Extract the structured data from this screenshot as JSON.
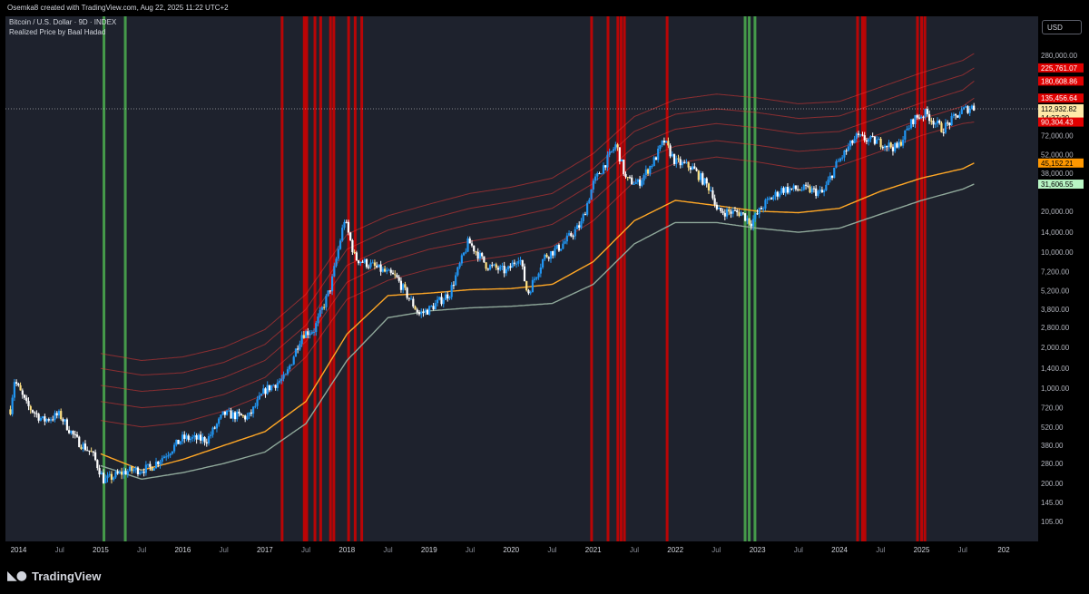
{
  "header": {
    "attribution": "Osemka8 created with TradingView.com, Aug 22, 2025 11:22 UTC+2"
  },
  "legend": {
    "symbol": "Bitcoin / U.S. Dollar · 9D · INDEX",
    "indicator": "Realized Price by Baal Hadad"
  },
  "currency": "USD",
  "footer": {
    "brand": "TradingView",
    "logo_icon": "tradingview-logo-icon"
  },
  "colors": {
    "background": "#1e222d",
    "candle_up": "#2196f3",
    "candle_down": "#ffffff",
    "candle_highlight": "#ffe082",
    "realized_band": "#e53935",
    "realized_price": "#ffa726",
    "lower_band": "#8fa89a",
    "red_zone": "#d50000",
    "green_zone": "#4caf50"
  },
  "chart_data": {
    "type": "candlestick",
    "title": "Bitcoin / U.S. Dollar · 9D · INDEX",
    "yscale": "log",
    "ylim": [
      75,
      540000
    ],
    "xlim": [
      2013.84,
      2026.42
    ],
    "grid": false,
    "y_ticks": [
      105,
      145,
      200,
      280,
      380,
      520,
      720,
      1000,
      1400,
      2000,
      2800,
      3800,
      5200,
      7200,
      10000,
      14000,
      20000,
      38000,
      52000,
      72000,
      280000
    ],
    "y_tick_labels": [
      "105.00",
      "145.00",
      "200.00",
      "280.00",
      "380.00",
      "520.00",
      "720.00",
      "1,000.00",
      "1,400.00",
      "2,000.00",
      "2,800.00",
      "3,800.00",
      "5,200.00",
      "7,200.00",
      "10,000.00",
      "14,000.00",
      "20,000.00",
      "38,000.00",
      "52,000.00",
      "72,000.00",
      "280,000.00"
    ],
    "x_ticks": [
      {
        "t": 2014.0,
        "label": "2014"
      },
      {
        "t": 2014.5,
        "label": "Jul"
      },
      {
        "t": 2015.0,
        "label": "2015"
      },
      {
        "t": 2015.5,
        "label": "Jul"
      },
      {
        "t": 2016.0,
        "label": "2016"
      },
      {
        "t": 2016.5,
        "label": "Jul"
      },
      {
        "t": 2017.0,
        "label": "2017"
      },
      {
        "t": 2017.5,
        "label": "Jul"
      },
      {
        "t": 2018.0,
        "label": "2018"
      },
      {
        "t": 2018.5,
        "label": "Jul"
      },
      {
        "t": 2019.0,
        "label": "2019"
      },
      {
        "t": 2019.5,
        "label": "Jul"
      },
      {
        "t": 2020.0,
        "label": "2020"
      },
      {
        "t": 2020.5,
        "label": "Jul"
      },
      {
        "t": 2021.0,
        "label": "2021"
      },
      {
        "t": 2021.5,
        "label": "Jul"
      },
      {
        "t": 2022.0,
        "label": "2022"
      },
      {
        "t": 2022.5,
        "label": "Jul"
      },
      {
        "t": 2023.0,
        "label": "2023"
      },
      {
        "t": 2023.5,
        "label": "Jul"
      },
      {
        "t": 2024.0,
        "label": "2024"
      },
      {
        "t": 2024.5,
        "label": "Jul"
      },
      {
        "t": 2025.0,
        "label": "2025"
      },
      {
        "t": 2025.5,
        "label": "Jul"
      },
      {
        "t": 2026.0,
        "label": "202"
      }
    ],
    "price_path": [
      [
        2013.9,
        700
      ],
      [
        2013.95,
        1150
      ],
      [
        2014.1,
        750
      ],
      [
        2014.3,
        580
      ],
      [
        2014.5,
        640
      ],
      [
        2014.7,
        420
      ],
      [
        2014.9,
        330
      ],
      [
        2015.04,
        210
      ],
      [
        2015.3,
        245
      ],
      [
        2015.6,
        260
      ],
      [
        2015.8,
        330
      ],
      [
        2016.0,
        430
      ],
      [
        2016.3,
        420
      ],
      [
        2016.5,
        650
      ],
      [
        2016.8,
        610
      ],
      [
        2017.0,
        970
      ],
      [
        2017.25,
        1200
      ],
      [
        2017.45,
        2500
      ],
      [
        2017.6,
        2700
      ],
      [
        2017.8,
        5500
      ],
      [
        2017.97,
        17500
      ],
      [
        2018.1,
        9000
      ],
      [
        2018.3,
        8000
      ],
      [
        2018.6,
        6500
      ],
      [
        2018.88,
        3500
      ],
      [
        2019.0,
        3800
      ],
      [
        2019.25,
        5000
      ],
      [
        2019.48,
        12000
      ],
      [
        2019.7,
        8000
      ],
      [
        2019.95,
        7200
      ],
      [
        2020.1,
        9500
      ],
      [
        2020.2,
        4900
      ],
      [
        2020.4,
        9200
      ],
      [
        2020.6,
        11000
      ],
      [
        2020.85,
        16000
      ],
      [
        2021.0,
        32000
      ],
      [
        2021.28,
        62000
      ],
      [
        2021.4,
        34000
      ],
      [
        2021.55,
        32000
      ],
      [
        2021.75,
        48000
      ],
      [
        2021.86,
        66000
      ],
      [
        2022.0,
        46000
      ],
      [
        2022.2,
        42000
      ],
      [
        2022.45,
        28000
      ],
      [
        2022.5,
        20000
      ],
      [
        2022.8,
        19500
      ],
      [
        2022.92,
        16500
      ],
      [
        2023.1,
        23000
      ],
      [
        2023.3,
        29000
      ],
      [
        2023.6,
        29000
      ],
      [
        2023.8,
        27000
      ],
      [
        2023.95,
        43000
      ],
      [
        2024.2,
        70000
      ],
      [
        2024.5,
        64000
      ],
      [
        2024.7,
        58000
      ],
      [
        2024.9,
        95000
      ],
      [
        2025.05,
        105000
      ],
      [
        2025.25,
        80000
      ],
      [
        2025.5,
        110000
      ],
      [
        2025.63,
        118000
      ],
      [
        2025.64,
        112932.82
      ]
    ],
    "series": [
      {
        "name": "Realized Price",
        "role": "realized-price",
        "color": "#ffa726",
        "points": [
          [
            2015.0,
            330
          ],
          [
            2015.5,
            250
          ],
          [
            2016.0,
            300
          ],
          [
            2016.5,
            380
          ],
          [
            2017.0,
            480
          ],
          [
            2017.5,
            800
          ],
          [
            2018.0,
            2500
          ],
          [
            2018.5,
            4800
          ],
          [
            2019.0,
            5000
          ],
          [
            2019.5,
            5300
          ],
          [
            2020.0,
            5400
          ],
          [
            2020.5,
            5800
          ],
          [
            2021.0,
            8500
          ],
          [
            2021.5,
            17000
          ],
          [
            2022.0,
            24000
          ],
          [
            2022.5,
            22000
          ],
          [
            2023.0,
            20000
          ],
          [
            2023.5,
            19500
          ],
          [
            2024.0,
            21000
          ],
          [
            2024.5,
            28000
          ],
          [
            2025.0,
            35000
          ],
          [
            2025.5,
            41000
          ],
          [
            2025.64,
            45152.21
          ]
        ]
      },
      {
        "name": "Lower Band",
        "role": "lower-band",
        "color": "#8fa89a",
        "points": [
          [
            2015.0,
            270
          ],
          [
            2015.5,
            215
          ],
          [
            2016.0,
            240
          ],
          [
            2016.5,
            280
          ],
          [
            2017.0,
            340
          ],
          [
            2017.5,
            550
          ],
          [
            2018.0,
            1600
          ],
          [
            2018.5,
            3300
          ],
          [
            2019.0,
            3700
          ],
          [
            2019.5,
            3900
          ],
          [
            2020.0,
            4000
          ],
          [
            2020.5,
            4200
          ],
          [
            2021.0,
            5800
          ],
          [
            2021.5,
            11500
          ],
          [
            2022.0,
            16500
          ],
          [
            2022.5,
            16500
          ],
          [
            2023.0,
            15000
          ],
          [
            2023.5,
            14000
          ],
          [
            2024.0,
            15000
          ],
          [
            2024.5,
            19000
          ],
          [
            2025.0,
            24000
          ],
          [
            2025.5,
            29000
          ],
          [
            2025.64,
            31606.55
          ]
        ]
      },
      {
        "name": "Band 1",
        "role": "red-band",
        "color": "#e53935",
        "points": [
          [
            2015.0,
            580
          ],
          [
            2015.5,
            520
          ],
          [
            2016.0,
            560
          ],
          [
            2016.5,
            680
          ],
          [
            2017.0,
            900
          ],
          [
            2017.5,
            1700
          ],
          [
            2018.0,
            4500
          ],
          [
            2018.5,
            6200
          ],
          [
            2019.0,
            7500
          ],
          [
            2019.5,
            8600
          ],
          [
            2020.0,
            9500
          ],
          [
            2020.5,
            11000
          ],
          [
            2021.0,
            17000
          ],
          [
            2021.5,
            33000
          ],
          [
            2022.0,
            45000
          ],
          [
            2022.5,
            50000
          ],
          [
            2023.0,
            46000
          ],
          [
            2023.5,
            41000
          ],
          [
            2024.0,
            43000
          ],
          [
            2024.5,
            55000
          ],
          [
            2025.0,
            72000
          ],
          [
            2025.5,
            88000
          ],
          [
            2025.64,
            90304.43
          ]
        ]
      },
      {
        "name": "Band 2",
        "role": "red-band",
        "color": "#e53935",
        "points": [
          [
            2015.0,
            800
          ],
          [
            2015.5,
            720
          ],
          [
            2016.0,
            760
          ],
          [
            2016.5,
            900
          ],
          [
            2017.0,
            1200
          ],
          [
            2017.5,
            2200
          ],
          [
            2018.0,
            6000
          ],
          [
            2018.5,
            8500
          ],
          [
            2019.0,
            10500
          ],
          [
            2019.5,
            12000
          ],
          [
            2020.0,
            13500
          ],
          [
            2020.5,
            16000
          ],
          [
            2021.0,
            24000
          ],
          [
            2021.5,
            45000
          ],
          [
            2022.0,
            60000
          ],
          [
            2022.5,
            66000
          ],
          [
            2023.0,
            61000
          ],
          [
            2023.5,
            55000
          ],
          [
            2024.0,
            58000
          ],
          [
            2024.5,
            74000
          ],
          [
            2025.0,
            95000
          ],
          [
            2025.5,
            118000
          ],
          [
            2025.64,
            135456.64
          ]
        ]
      },
      {
        "name": "Band 3",
        "role": "red-band",
        "color": "#e53935",
        "points": [
          [
            2015.0,
            1050
          ],
          [
            2015.5,
            950
          ],
          [
            2016.0,
            1000
          ],
          [
            2016.5,
            1200
          ],
          [
            2017.0,
            1600
          ],
          [
            2017.5,
            2900
          ],
          [
            2018.0,
            8000
          ],
          [
            2018.5,
            11000
          ],
          [
            2019.0,
            13500
          ],
          [
            2019.5,
            16000
          ],
          [
            2020.0,
            18000
          ],
          [
            2020.5,
            21000
          ],
          [
            2021.0,
            32000
          ],
          [
            2021.5,
            60000
          ],
          [
            2022.0,
            80000
          ],
          [
            2022.5,
            88000
          ],
          [
            2023.0,
            82000
          ],
          [
            2023.5,
            74000
          ],
          [
            2024.0,
            77000
          ],
          [
            2024.5,
            98000
          ],
          [
            2025.0,
            125000
          ],
          [
            2025.5,
            155000
          ],
          [
            2025.64,
            180608.86
          ]
        ]
      },
      {
        "name": "Band 4",
        "role": "red-band",
        "color": "#e53935",
        "points": [
          [
            2015.0,
            1400
          ],
          [
            2015.5,
            1250
          ],
          [
            2016.0,
            1300
          ],
          [
            2016.5,
            1550
          ],
          [
            2017.0,
            2100
          ],
          [
            2017.5,
            3800
          ],
          [
            2018.0,
            10500
          ],
          [
            2018.5,
            14500
          ],
          [
            2019.0,
            17500
          ],
          [
            2019.5,
            21000
          ],
          [
            2020.0,
            23500
          ],
          [
            2020.5,
            27000
          ],
          [
            2021.0,
            41000
          ],
          [
            2021.5,
            77000
          ],
          [
            2022.0,
            103000
          ],
          [
            2022.5,
            113000
          ],
          [
            2023.0,
            106000
          ],
          [
            2023.5,
            96000
          ],
          [
            2024.0,
            100000
          ],
          [
            2024.5,
            127000
          ],
          [
            2025.0,
            162000
          ],
          [
            2025.5,
            200000
          ],
          [
            2025.64,
            225761.07
          ]
        ]
      },
      {
        "name": "Band 5",
        "role": "red-band",
        "color": "#e53935",
        "points": [
          [
            2015.0,
            1800
          ],
          [
            2015.5,
            1600
          ],
          [
            2016.0,
            1700
          ],
          [
            2016.5,
            2000
          ],
          [
            2017.0,
            2700
          ],
          [
            2017.5,
            4900
          ],
          [
            2018.0,
            13500
          ],
          [
            2018.5,
            18500
          ],
          [
            2019.0,
            22500
          ],
          [
            2019.5,
            27000
          ],
          [
            2020.0,
            30000
          ],
          [
            2020.5,
            35000
          ],
          [
            2021.0,
            53000
          ],
          [
            2021.5,
            99000
          ],
          [
            2022.0,
            132000
          ],
          [
            2022.5,
            145000
          ],
          [
            2023.0,
            136000
          ],
          [
            2023.5,
            123000
          ],
          [
            2024.0,
            128000
          ],
          [
            2024.5,
            163000
          ],
          [
            2025.0,
            208000
          ],
          [
            2025.5,
            256000
          ],
          [
            2025.64,
            288000
          ]
        ]
      }
    ],
    "red_zones": [
      2017.21,
      2017.48,
      2017.51,
      2017.61,
      2017.68,
      2017.8,
      2017.84,
      2018.02,
      2018.1,
      2018.18,
      2020.98,
      2021.18,
      2021.3,
      2021.34,
      2021.38,
      2021.9,
      2024.22,
      2024.28,
      2024.31,
      2024.95,
      2025.0,
      2025.04
    ],
    "green_zones": [
      2015.04,
      2015.3,
      2022.85,
      2022.9,
      2022.97
    ],
    "current_price_line": 112932.82,
    "price_labels": [
      {
        "value": 225761.07,
        "label": "225,761.07",
        "kind": "red"
      },
      {
        "value": 180608.86,
        "label": "180,608.86",
        "kind": "red"
      },
      {
        "value": 135456.64,
        "label": "135,456.64",
        "kind": "red"
      },
      {
        "value": 112932.82,
        "label": "112,932.82",
        "kind": "current"
      },
      {
        "value": 90304.43,
        "label": "90,304.43",
        "kind": "red"
      },
      {
        "value": 45152.21,
        "label": "45,152.21",
        "kind": "orange"
      },
      {
        "value": 31606.55,
        "label": "31,606.55",
        "kind": "green"
      }
    ],
    "countdown": "14:37:29"
  }
}
